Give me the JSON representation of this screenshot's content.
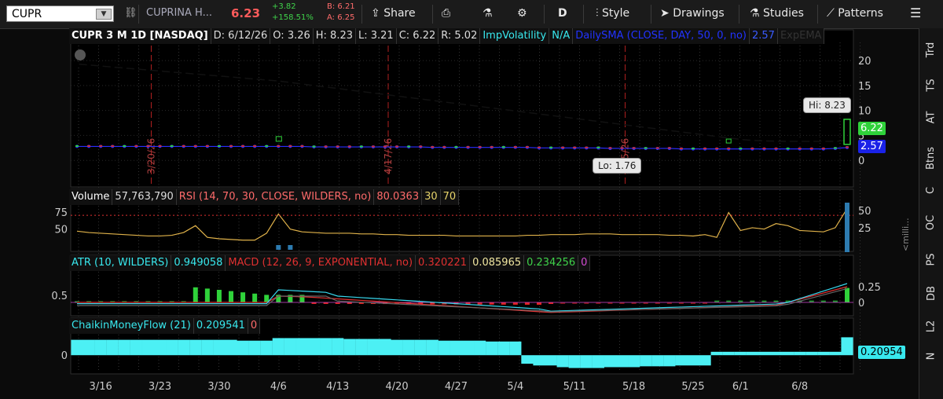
{
  "toolbar": {
    "symbol": "CUPR",
    "company": "CUPRINA H...",
    "last": "6.23",
    "change": "+3.82",
    "change_pct": "+158.51%",
    "bid": "B: 6.21",
    "ask": "A: 6.25",
    "share": "Share",
    "period": "D",
    "style": "Style",
    "drawings": "Drawings",
    "studies": "Studies",
    "patterns": "Patterns"
  },
  "price_header": {
    "title": "CUPR 3 M 1D [NASDAQ]",
    "d": "D: 6/12/26",
    "o": "O: 3.26",
    "h": "H: 8.23",
    "l": "L: 3.21",
    "c": "C: 6.22",
    "r": "R: 5.02",
    "impvol": "ImpVolatility",
    "impvol_val": "N/A",
    "sma": "DailySMA (CLOSE, DAY, 50, 0, no)",
    "sma_val": "2.57",
    "ema": "ExpEMA"
  },
  "volume_header": {
    "label": "Volume",
    "value": "57,763,790",
    "rsi": "RSI (14, 70, 30, CLOSE, WILDERS, no)",
    "rsi_val": "80.0363",
    "lo": "30",
    "hi": "70"
  },
  "atr_header": {
    "atr": "ATR (10, WILDERS)",
    "atr_val": "0.949058",
    "macd": "MACD (12, 26, 9, EXPONENTIAL, no)",
    "macd_val": "0.320221",
    "macd_avg": "0.085965",
    "macd_diff": "0.234256",
    "zero": "0"
  },
  "cmf_header": {
    "label": "ChaikinMoneyFlow (21)",
    "value": "0.209541",
    "zero": "0"
  },
  "annotations": {
    "hi": "Hi: 8.23",
    "lo": "Lo: 1.76",
    "price_now": "6.22",
    "sma_now": "2.57",
    "cmf_now": "0.20954",
    "vline1": "3/20/26",
    "vline2": "4/17/26",
    "vline3": "5/15/26"
  },
  "axes": {
    "price_ticks": [
      "20",
      "15",
      "10",
      "5",
      "0"
    ],
    "vol_ticks": [
      "50",
      "25"
    ],
    "rsi_ticks": [
      "75",
      "50"
    ],
    "macd_ticks": [
      "0.25",
      "0"
    ],
    "atr_ticks": [
      "0.5"
    ],
    "cmf_ticks": [
      "0"
    ],
    "x_ticks": [
      "3/16",
      "3/23",
      "3/30",
      "4/6",
      "4/13",
      "4/20",
      "4/27",
      "5/4",
      "5/11",
      "5/18",
      "5/25",
      "6/1",
      "6/8"
    ],
    "vol_axis_label": "<milli..."
  },
  "right_tabs": [
    "Trd",
    "TS",
    "AT",
    "Btns",
    "C",
    "OC",
    "PS",
    "DB",
    "L2",
    "N"
  ],
  "chart_data": {
    "type": "line",
    "x": [
      "3/12",
      "3/13",
      "3/16",
      "3/17",
      "3/18",
      "3/19",
      "3/20",
      "3/23",
      "3/24",
      "3/25",
      "3/26",
      "3/27",
      "3/30",
      "3/31",
      "4/1",
      "4/2",
      "4/3",
      "4/6",
      "4/7",
      "4/8",
      "4/9",
      "4/10",
      "4/13",
      "4/14",
      "4/15",
      "4/16",
      "4/17",
      "4/20",
      "4/21",
      "4/22",
      "4/23",
      "4/24",
      "4/27",
      "4/28",
      "4/29",
      "4/30",
      "5/1",
      "5/4",
      "5/5",
      "5/6",
      "5/7",
      "5/8",
      "5/11",
      "5/12",
      "5/13",
      "5/14",
      "5/15",
      "5/18",
      "5/19",
      "5/20",
      "5/21",
      "5/22",
      "5/26",
      "5/27",
      "5/28",
      "5/29",
      "6/1",
      "6/2",
      "6/3",
      "6/4",
      "6/5",
      "6/8",
      "6/9",
      "6/10",
      "6/11",
      "6/12"
    ],
    "series": [
      {
        "name": "ExpEMA",
        "values": [
          19.3,
          19.1,
          18.9,
          18.7,
          18.5,
          18.3,
          18.1,
          17.9,
          17.7,
          17.5,
          17.3,
          17.1,
          16.9,
          16.7,
          16.5,
          16.3,
          16.1,
          15.9,
          15.6,
          15.3,
          15.0,
          14.7,
          14.4,
          14.1,
          13.8,
          13.5,
          13.2,
          12.9,
          12.6,
          12.3,
          12.0,
          11.7,
          11.4,
          11.1,
          10.8,
          10.5,
          10.2,
          9.9,
          9.6,
          9.3,
          9.0,
          8.7,
          8.4,
          8.1,
          7.8,
          7.5,
          7.2,
          6.9,
          6.6,
          6.3,
          6.0,
          5.7,
          5.4,
          5.1,
          4.8,
          4.5,
          4.2,
          4.0,
          3.9,
          3.85,
          3.8,
          3.8,
          3.8,
          3.8,
          3.8,
          4.0
        ]
      },
      {
        "name": "DailySMA",
        "values": [
          2.8,
          2.8,
          2.8,
          2.8,
          2.8,
          2.8,
          2.8,
          2.8,
          2.8,
          2.8,
          2.8,
          2.8,
          2.8,
          2.8,
          2.8,
          2.8,
          2.8,
          2.8,
          2.8,
          2.8,
          2.7,
          2.7,
          2.7,
          2.7,
          2.7,
          2.7,
          2.7,
          2.7,
          2.7,
          2.7,
          2.6,
          2.6,
          2.6,
          2.6,
          2.6,
          2.6,
          2.6,
          2.6,
          2.6,
          2.5,
          2.5,
          2.5,
          2.5,
          2.5,
          2.5,
          2.4,
          2.4,
          2.4,
          2.4,
          2.4,
          2.4,
          2.3,
          2.3,
          2.3,
          2.3,
          2.3,
          2.3,
          2.3,
          2.3,
          2.3,
          2.3,
          2.3,
          2.3,
          2.3,
          2.4,
          2.57
        ]
      }
    ],
    "price_ylim": [
      -5,
      23
    ],
    "high": 8.23,
    "low": 1.76,
    "rsi": [
      47,
      45,
      44,
      43,
      42,
      41,
      40,
      40,
      41,
      45,
      55,
      38,
      36,
      35,
      34,
      34,
      44,
      72,
      50,
      46,
      45,
      44,
      44,
      44,
      43,
      43,
      42,
      42,
      41,
      41,
      41,
      41,
      40,
      40,
      40,
      40,
      40,
      40,
      41,
      41,
      42,
      42,
      42,
      43,
      43,
      43,
      42,
      42,
      42,
      42,
      41,
      41,
      40,
      42,
      38,
      74,
      48,
      52,
      50,
      58,
      55,
      48,
      47,
      46,
      52,
      80
    ],
    "rsi_ylim": [
      20,
      85
    ],
    "cmf": [
      0.18,
      0.18,
      0.18,
      0.18,
      0.18,
      0.18,
      0.18,
      0.18,
      0.18,
      0.18,
      0.18,
      0.18,
      0.18,
      0.18,
      0.17,
      0.17,
      0.17,
      0.2,
      0.2,
      0.2,
      0.2,
      0.2,
      0.2,
      0.19,
      0.19,
      0.19,
      0.19,
      0.18,
      0.18,
      0.18,
      0.18,
      0.17,
      0.17,
      0.17,
      0.17,
      0.16,
      0.16,
      0.16,
      -0.1,
      -0.12,
      -0.12,
      -0.14,
      -0.15,
      -0.15,
      -0.15,
      -0.14,
      -0.14,
      -0.14,
      -0.13,
      -0.13,
      -0.13,
      -0.12,
      -0.12,
      -0.12,
      0.04,
      0.04,
      0.04,
      0.04,
      0.04,
      0.04,
      0.04,
      0.04,
      0.04,
      0.04,
      0.04,
      0.2095
    ],
    "cmf_ylim": [
      -0.2,
      0.25
    ]
  }
}
